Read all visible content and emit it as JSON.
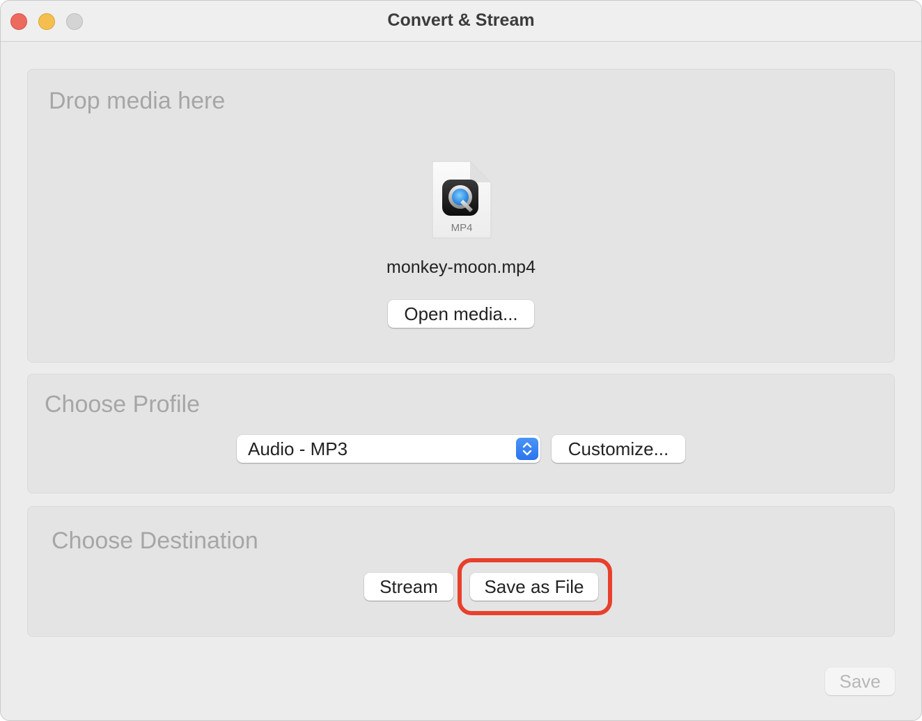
{
  "window": {
    "title": "Convert & Stream",
    "controls": [
      "close",
      "minimize",
      "zoom"
    ]
  },
  "drop_panel": {
    "heading": "Drop media here",
    "file": {
      "icon": "quicktime-mp4-file-icon",
      "type_label": "MP4",
      "name": "monkey-moon.mp4"
    },
    "open_button": "Open media..."
  },
  "profile_panel": {
    "heading": "Choose Profile",
    "selected_profile": "Audio - MP3",
    "customize_button": "Customize..."
  },
  "destination_panel": {
    "heading": "Choose Destination",
    "stream_button": "Stream",
    "save_as_file_button": "Save as File",
    "highlight_color": "#e8402c"
  },
  "footer": {
    "save_button": "Save",
    "save_enabled": false
  },
  "colors": {
    "accent": "#2f7bf0",
    "close": "#ed6a5e",
    "minimize": "#f5bf4f",
    "zoom_disabled": "#d4d4d4"
  }
}
